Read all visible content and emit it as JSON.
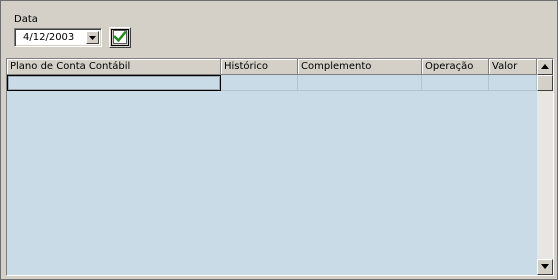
{
  "filter": {
    "date_label": "Data",
    "date_value": "4/12/2003"
  },
  "grid": {
    "columns": [
      {
        "label": "Plano de Conta Contábil"
      },
      {
        "label": "Histórico"
      },
      {
        "label": "Complemento"
      },
      {
        "label": "Operação"
      },
      {
        "label": "Valor"
      }
    ],
    "rows": [
      [
        "",
        "",
        "",
        "",
        ""
      ]
    ]
  },
  "icons": {
    "dropdown": "chevron-down-icon",
    "confirm": "checkmark-icon",
    "scroll_up": "arrow-up-icon",
    "scroll_down": "arrow-down-icon"
  },
  "colors": {
    "window_bg": "#d4d0c8",
    "grid_bg": "#c9dbe6",
    "check_green": "#1f8a1f"
  }
}
